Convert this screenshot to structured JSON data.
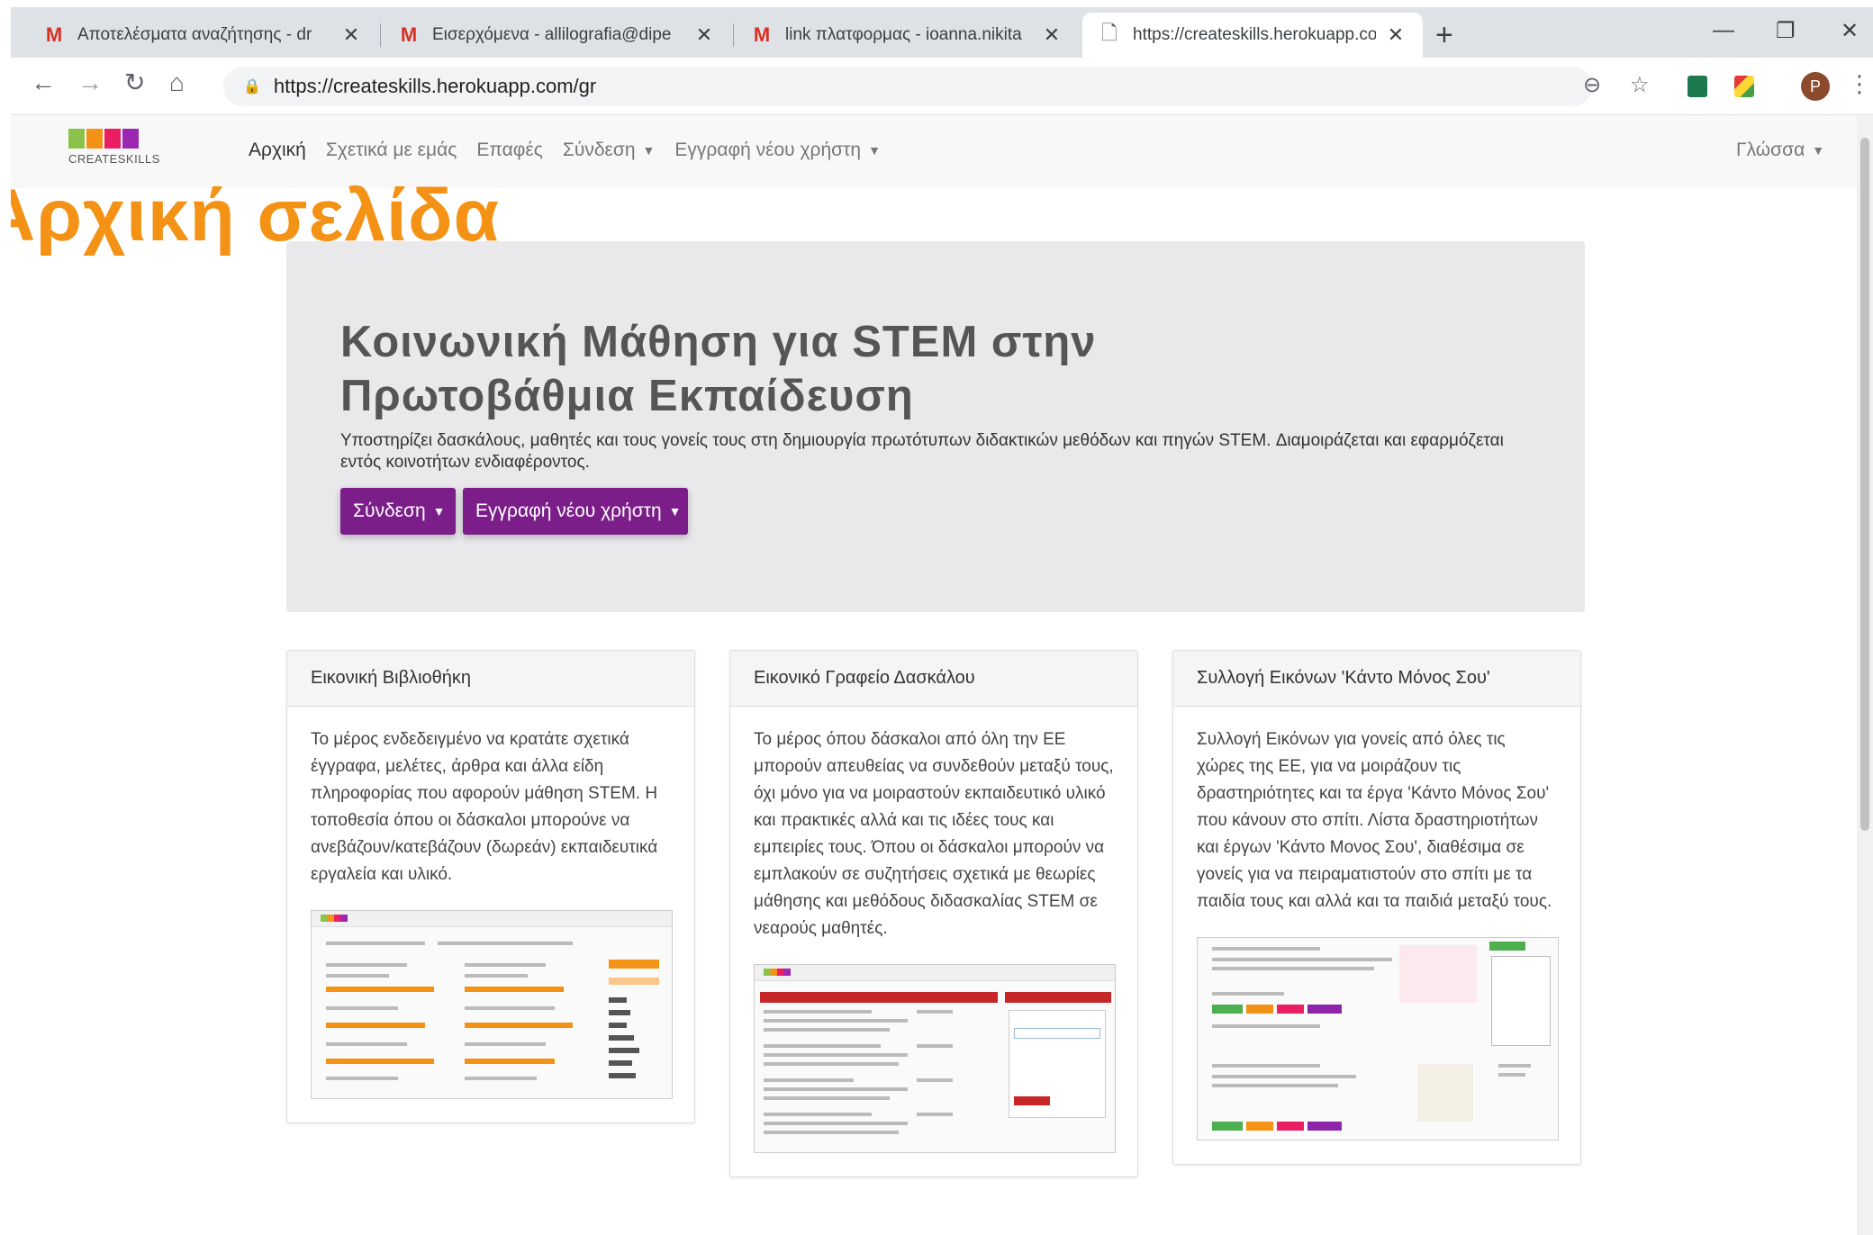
{
  "browser": {
    "tabs": [
      {
        "favicon": "gmail-icon",
        "title": "Αποτελέσματα αναζήτησης - dr"
      },
      {
        "favicon": "gmail-icon",
        "title": "Εισερχόμενα - allilografia@dipe"
      },
      {
        "favicon": "gmail-icon",
        "title": "link πλατφορμας - ioanna.nikita"
      },
      {
        "favicon": "document-icon",
        "title": "https://createskills.herokuapp.co"
      }
    ],
    "url": "https://createskills.herokuapp.com/gr"
  },
  "site": {
    "logo_text": "CREATESKILLS",
    "nav": {
      "home": "Αρχική",
      "about": "Σχετικά με εμάς",
      "contact": "Επαφές",
      "login": "Σύνδεση",
      "register": "Εγγραφή νέου χρήστη",
      "language": "Γλώσσα"
    }
  },
  "overlay_title": "Αρχική σελίδα",
  "jumbotron": {
    "title": "Κοινωνική Μάθηση για STEM στην Πρωτοβάθμια Εκπαίδευση",
    "description": "Υποστηρίζει δασκάλους, μαθητές και τους γονείς τους στη δημιουργία πρωτότυπων διδακτικών μεθόδων και πηγών STEM. Διαμοιράζεται και εφαρμόζεται εντός κοινοτήτων ενδιαφέροντος.",
    "login_button": "Σύνδεση",
    "register_button": "Εγγραφή νέου χρήστη"
  },
  "cards": [
    {
      "title": "Εικονική Βιβλιοθήκη",
      "body": "Το μέρος ενδεδειγμένο να κρατάτε σχετικά έγγραφα, μελέτες, άρθρα και άλλα είδη πληροφορίας που αφορούν μάθηση STEM. Η τοποθεσία όπου οι δάσκαλοι μπορούνε να ανεβάζουν/κατεβάζουν (δωρεάν) εκπαιδευτικά εργαλεία και υλικό."
    },
    {
      "title": "Εικονικό Γραφείο Δασκάλου",
      "body": "Το μέρος όπου δάσκαλοι από όλη την ΕΕ μπορούν απευθείας να συνδεθούν μεταξύ τους, όχι μόνο για να μοιραστούν εκπαιδευτικό υλικό και πρακτικές αλλά και τις ιδέες τους και εμπειρίες τους. Όπου οι δάσκαλοι μπορούν να εμπλακούν σε συζητήσεις σχετικά με θεωρίες μάθησης και μεθόδους διδασκαλίας STEM σε νεαρούς μαθητές."
    },
    {
      "title": "Συλλογή Εικόνων 'Κάντο Μόνος Σου'",
      "body": "Συλλογή Εικόνων για γονείς από όλες τις χώρες της ΕΕ, για να μοιράζουν τις δραστηριότητες και τα έργα 'Κάντο Μόνος Σου' που κάνουν στο σπίτι. Λίστα δραστηριοτήτων και έργων 'Κάντο Μονος Σου', διαθέσιμα σε γονείς για να πειραματιστούν στο σπίτι με τα παιδία τους και αλλά και τα παιδιά μεταξύ τους."
    }
  ],
  "colors": {
    "accent_orange": "#f39214",
    "button_purple": "#7b1e8a",
    "jumbotron_bg": "#e9e9ec"
  }
}
